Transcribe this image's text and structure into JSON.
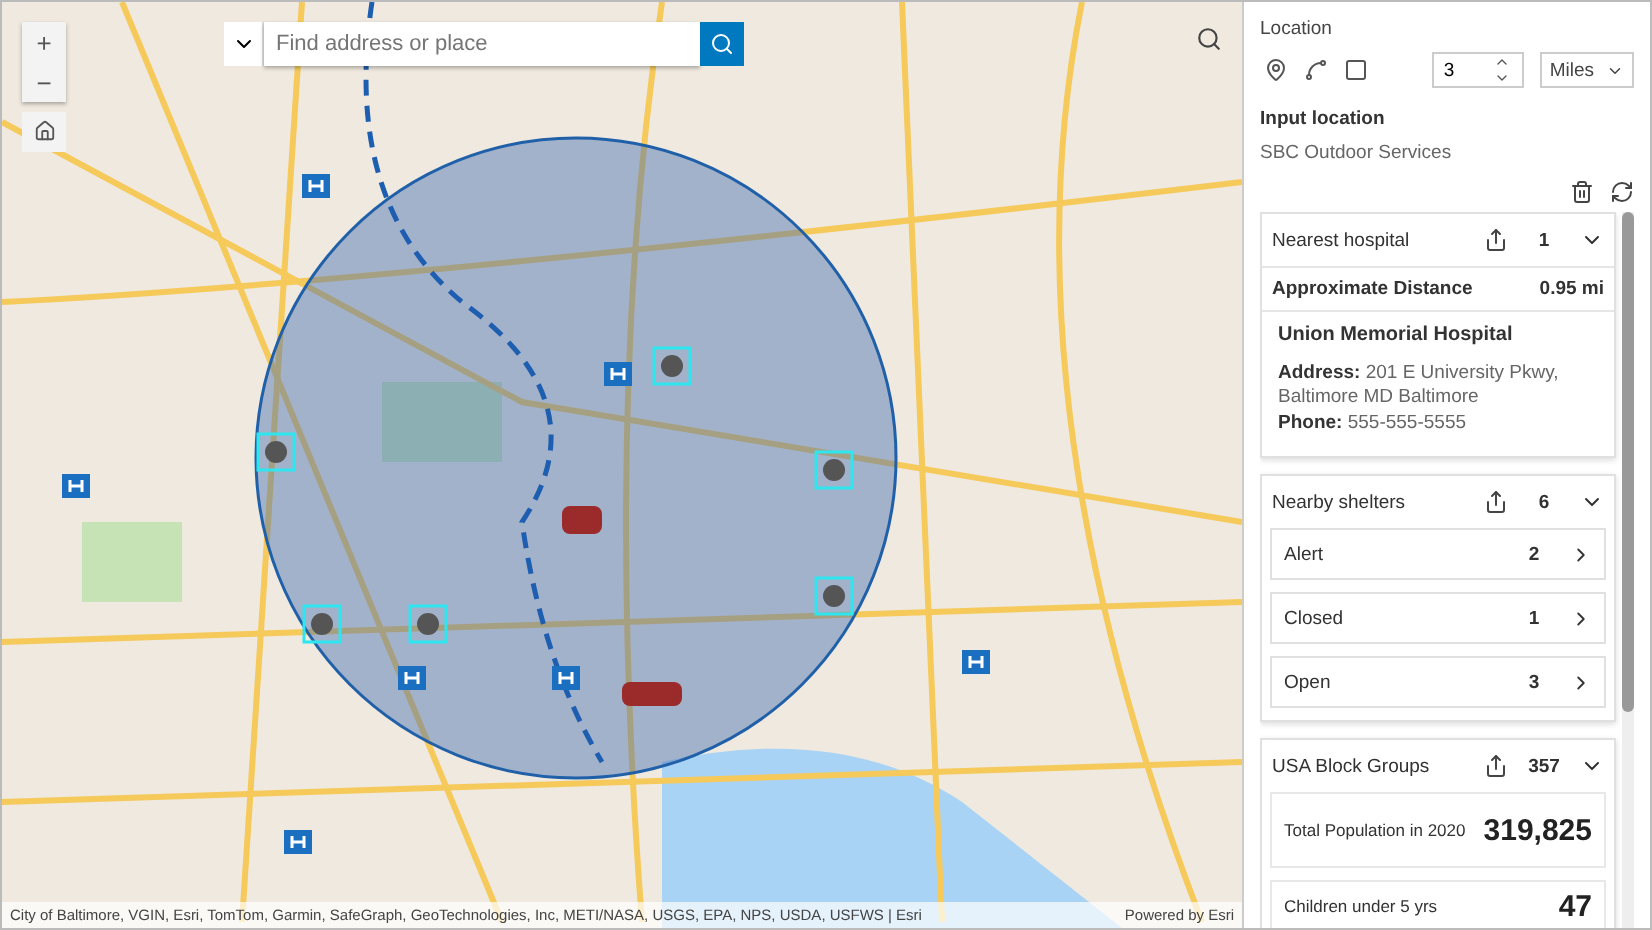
{
  "map": {
    "search": {
      "placeholder": "Find address or place"
    },
    "zoom_in": "+",
    "zoom_out": "−",
    "attribution": "City of Baltimore, VGIN, Esri, TomTom, Garmin, SafeGraph, GeoTechnologies, Inc, METI/NASA, USGS, EPA, NPS, USDA, USFWS | Esri",
    "powered_by": "Powered by Esri"
  },
  "panel": {
    "location_label": "Location",
    "distance": "3",
    "unit": "Miles",
    "input_location_label": "Input location",
    "input_location": "SBC Outdoor Services",
    "nearest_hospital": {
      "title": "Nearest hospital",
      "count": "1",
      "expanded": true,
      "distance_label": "Approximate Distance",
      "distance_value": "0.95 mi",
      "name": "Union Memorial Hospital",
      "address_label": "Address:",
      "address": "201 E University Pkwy, Baltimore MD Baltimore",
      "phone_label": "Phone:",
      "phone": "555-555-5555"
    },
    "shelters": {
      "title": "Nearby shelters",
      "count": "6",
      "expanded": true,
      "items": [
        {
          "label": "Alert",
          "count": "2"
        },
        {
          "label": "Closed",
          "count": "1"
        },
        {
          "label": "Open",
          "count": "3"
        }
      ]
    },
    "block_groups": {
      "title": "USA Block Groups",
      "count": "357",
      "expanded": true,
      "stats": [
        {
          "label": "Total Population in 2020",
          "value": "319,825"
        },
        {
          "label": "Children under 5 yrs",
          "value": "47"
        }
      ]
    }
  }
}
